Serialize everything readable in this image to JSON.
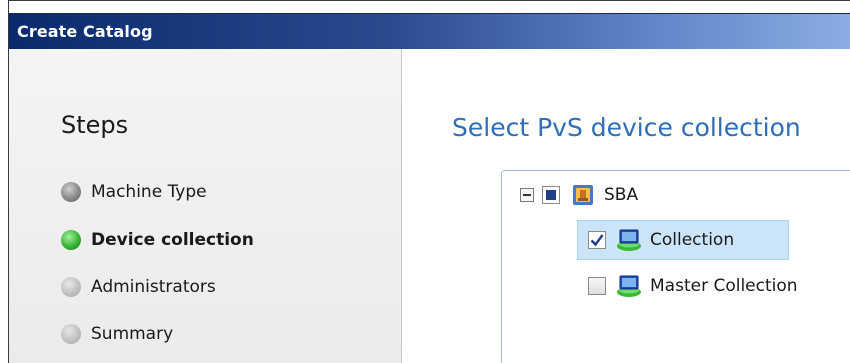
{
  "window": {
    "title": "Create Catalog"
  },
  "sidebar": {
    "title": "Steps",
    "steps": [
      {
        "label": "Machine Type",
        "status": "gray",
        "bold": false
      },
      {
        "label": "Device collection",
        "status": "green",
        "bold": true
      },
      {
        "label": "Administrators",
        "status": "light",
        "bold": false
      },
      {
        "label": "Summary",
        "status": "light",
        "bold": false
      }
    ]
  },
  "main": {
    "heading": "Select PvS device collection",
    "tree": {
      "root": {
        "label": "SBA",
        "icon": "site-icon",
        "expanded": true,
        "checked": "partial"
      },
      "children": [
        {
          "label": "Collection",
          "icon": "device-collection-icon",
          "checked": true,
          "selected": true
        },
        {
          "label": "Master Collection",
          "icon": "device-collection-icon",
          "checked": false,
          "selected": false
        }
      ]
    }
  },
  "colors": {
    "accent": "#2f6db7",
    "title_bar_start": "#0a2a6e",
    "title_bar_end": "#8aaee2",
    "selection": "#cce4f7",
    "status_green": "#35b535"
  }
}
